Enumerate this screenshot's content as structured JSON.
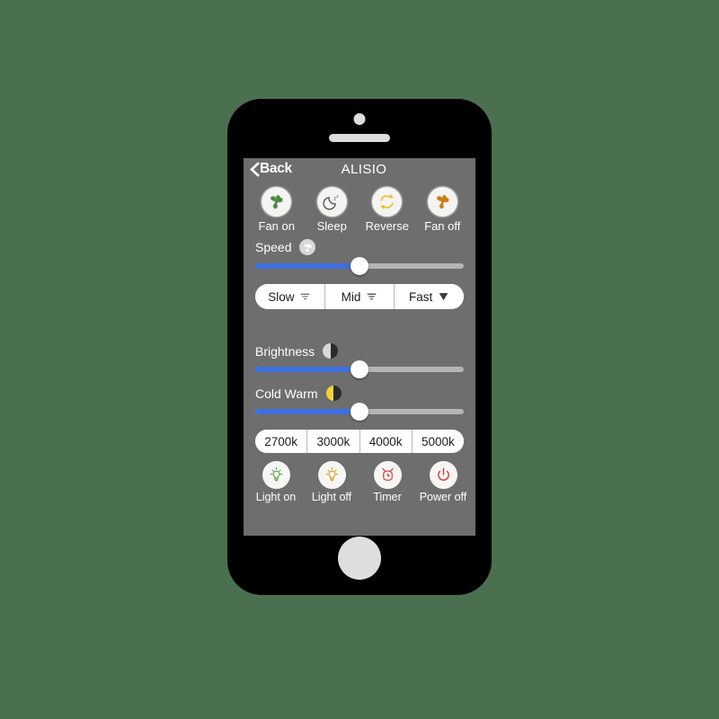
{
  "background_color": "#4a7050",
  "device": {
    "name": "smartphone-mockup",
    "body_color": "#000000",
    "camera_icon": "camera-dot",
    "speaker_icon": "speaker-grille",
    "home_button_icon": "home-button"
  },
  "screen": {
    "background_color": "#6e6e6e",
    "navbar": {
      "back_label": "Back",
      "back_icon": "chevron-left-icon",
      "title": "ALISIO"
    },
    "fan_modes": [
      {
        "label": "Fan on",
        "icon": "fan-icon",
        "color": "#4a8a3c"
      },
      {
        "label": "Sleep",
        "icon": "moon-sleep-icon",
        "color": "#4a4a4a"
      },
      {
        "label": "Reverse",
        "icon": "reverse-arrows-icon",
        "color": "#e8c01e"
      },
      {
        "label": "Fan off",
        "icon": "fan-icon",
        "color": "#c97f18"
      }
    ],
    "speed": {
      "label": "Speed",
      "icon": "fan-small-icon",
      "slider": {
        "name": "speed-slider",
        "value_percent": 50,
        "active_color": "#3d6fe0",
        "track_color": "#b5b5b5"
      },
      "presets": [
        {
          "label": "Slow",
          "icon": "wind-weak-icon"
        },
        {
          "label": "Mid",
          "icon": "wind-medium-icon"
        },
        {
          "label": "Fast",
          "icon": "wind-strong-icon"
        }
      ]
    },
    "brightness": {
      "label": "Brightness",
      "icon": "half-circle-brightness-icon",
      "icon_left_color": "#d8d8d8",
      "icon_right_color": "#2b2b2b",
      "slider": {
        "name": "brightness-slider",
        "value_percent": 50,
        "active_color": "#3d6fe0",
        "track_color": "#b5b5b5"
      }
    },
    "cold_warm": {
      "label": "Cold Warm",
      "icon": "half-circle-color-temp-icon",
      "icon_left_color": "#f2d23c",
      "icon_right_color": "#2b2b2b",
      "slider": {
        "name": "cold-warm-slider",
        "value_percent": 50,
        "active_color": "#3d6fe0",
        "track_color": "#b5b5b5"
      }
    },
    "color_temperatures": [
      {
        "label": "2700k"
      },
      {
        "label": "3000k"
      },
      {
        "label": "4000k"
      },
      {
        "label": "5000k"
      }
    ],
    "bottom_actions": [
      {
        "label": "Light on",
        "icon": "light-bulb-on-icon",
        "color": "#57a046"
      },
      {
        "label": "Light off",
        "icon": "light-bulb-off-icon",
        "color": "#d99b1f"
      },
      {
        "label": "Timer",
        "icon": "alarm-clock-icon",
        "color": "#d8342c"
      },
      {
        "label": "Power off",
        "icon": "power-icon",
        "color": "#d8342c"
      }
    ]
  }
}
